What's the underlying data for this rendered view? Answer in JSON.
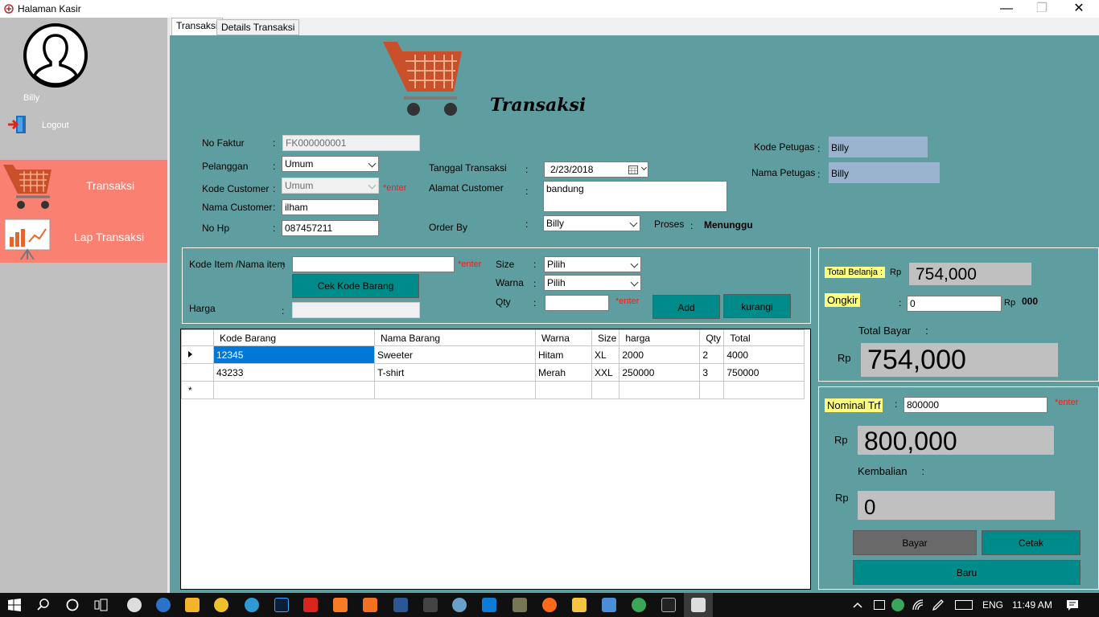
{
  "window": {
    "title": "Halaman Kasir",
    "minimize": "—",
    "maximize": "❐",
    "close": "✕"
  },
  "sidebar": {
    "user_name": "Billy",
    "logout_label": "Logout",
    "nav": [
      {
        "label": "Transaksi"
      },
      {
        "label": "Lap Transaksi"
      }
    ]
  },
  "tabs": [
    {
      "label": "Transaksi"
    },
    {
      "label": "Details Transaksi"
    }
  ],
  "header": {
    "title": "Transaksi"
  },
  "form": {
    "no_faktur": {
      "label": "No Faktur",
      "value": "FK000000001"
    },
    "pelanggan": {
      "label": "Pelanggan",
      "value": "Umum"
    },
    "kode_customer": {
      "label": "Kode Customer",
      "value": "Umum",
      "hint": "*enter"
    },
    "nama_customer": {
      "label": "Nama Customer",
      "value": "ilham"
    },
    "no_hp": {
      "label": "No Hp",
      "value": "087457211"
    },
    "tanggal": {
      "label": "Tanggal  Transaksi",
      "value": "2/23/2018"
    },
    "alamat": {
      "label": "Alamat Customer",
      "value": "bandung"
    },
    "order_by": {
      "label": "Order By",
      "value": "Billy"
    },
    "proses": {
      "label": "Proses",
      "value": "Menunggu"
    },
    "kode_petugas": {
      "label": "Kode Petugas",
      "value": "Billy"
    },
    "nama_petugas": {
      "label": "Nama Petugas",
      "value": "Billy"
    },
    "colon": ":"
  },
  "item": {
    "kode_label": "Kode Item /Nama item",
    "kode_value": "",
    "hint": "*enter",
    "cek_button": "Cek Kode Barang",
    "harga_label": "Harga",
    "harga_value": "",
    "size_label": "Size",
    "size_value": "Pilih",
    "warna_label": "Warna",
    "warna_value": "Pilih",
    "qty_label": "Qty",
    "qty_value": "",
    "qty_hint": "*enter",
    "add_button": "Add",
    "kurangi_button": "kurangi"
  },
  "table": {
    "columns": [
      "Kode Barang",
      "Nama Barang",
      "Warna",
      "Size",
      "harga",
      "Qty",
      "Total"
    ],
    "rows": [
      [
        "12345",
        "Sweeter",
        "Hitam",
        "XL",
        "2000",
        "2",
        "4000"
      ],
      [
        "43233",
        "T-shirt",
        "Merah",
        "XXL",
        "250000",
        "3",
        "750000"
      ]
    ],
    "new_row_marker": "*"
  },
  "summary": {
    "total_belanja_label": "Total Belanja  :",
    "rp": "Rp",
    "total_belanja_value": "754,000",
    "ongkir_label": "Ongkir",
    "ongkir_value": "0",
    "ongkir_suffix": "000",
    "total_bayar_label": "Total Bayar     :",
    "total_bayar_value": "754,000",
    "nominal_label": "Nominal Trf",
    "nominal_value": "800000",
    "nominal_hint": "*enter",
    "nominal_display": "800,000",
    "kembalian_label": "Kembalian     :",
    "kembalian_value": "0",
    "bayar_button": "Bayar",
    "cetak_button": "Cetak",
    "baru_button": "Baru"
  },
  "taskbar": {
    "lang": "ENG",
    "time": "11:49 AM"
  },
  "colors": {
    "teal_panel": "#5f9ea0",
    "accent_button": "#008b8b",
    "nav_active": "#fa8072",
    "highlight": "#ffff80"
  }
}
